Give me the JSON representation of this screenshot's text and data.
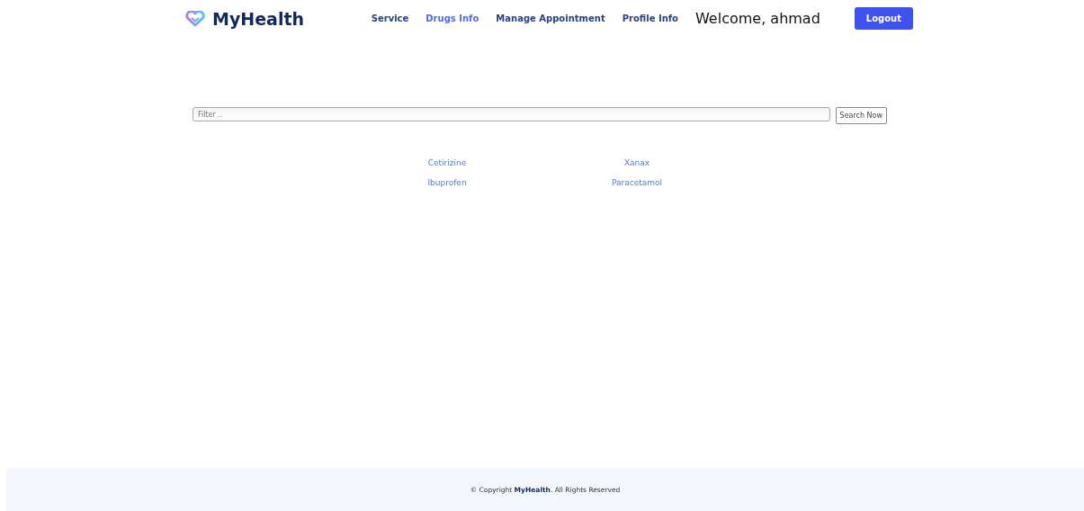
{
  "header": {
    "logo": "MyHealth",
    "nav": [
      {
        "label": "Service",
        "selected": false
      },
      {
        "label": "Drugs Info",
        "selected": true
      },
      {
        "label": "Manage Appointment",
        "selected": false
      },
      {
        "label": "Profile Info",
        "selected": false
      }
    ],
    "welcome": "Welcome, ahmad",
    "logout": "Logout"
  },
  "search": {
    "placeholder": "Filter ..",
    "button": "Search Now"
  },
  "drugs": [
    "Cetirizine",
    "Xanax",
    "Ibuprofen",
    "Paracetamol"
  ],
  "footer": {
    "text": "© Copyright **MyHealth**. All Rights Reserved"
  }
}
